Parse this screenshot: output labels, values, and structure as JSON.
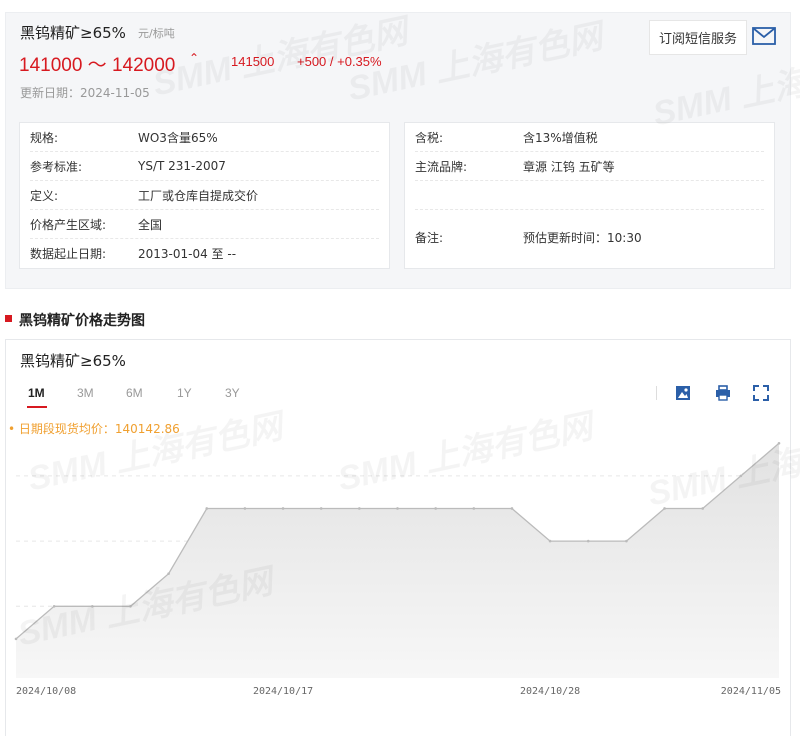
{
  "product": {
    "title": "黑钨精矿≥65%",
    "unit": "元/标吨",
    "price_range": "141000 ～ 142000",
    "trend_symbol": "⌃",
    "avg_price": "141500",
    "change": "+500 / +0.35%",
    "update_date": "更新日期：2024-11-05",
    "subscribe_label": "订阅短信服务"
  },
  "info_left": [
    {
      "key": "规格:",
      "value": "WO3含量65%"
    },
    {
      "key": "参考标准:",
      "value": "YS/T 231-2007"
    },
    {
      "key": "定义:",
      "value": "工厂或仓库自提成交价"
    },
    {
      "key": "价格产生区域:",
      "value": "全国"
    },
    {
      "key": "数据起止日期:",
      "value": "2013-01-04 至 --"
    }
  ],
  "info_right": [
    {
      "key": "含税:",
      "value": "含13%增值税"
    },
    {
      "key": "主流品牌:",
      "value": "章源 江钨 五矿等"
    },
    {
      "key": "",
      "value": ""
    },
    {
      "key": "备注:",
      "value": "预估更新时间：10:30"
    }
  ],
  "section_title": "黑钨精矿价格走势图",
  "chart_panel": {
    "title": "黑钨精矿≥65%",
    "tabs": [
      "1M",
      "3M",
      "6M",
      "1Y",
      "3Y"
    ],
    "active_tab": "1M",
    "avg_text": "• 日期段现货均价：140142.86"
  },
  "watermark": "SMM 上海有色网",
  "colors": {
    "accent": "#d71920",
    "avg_label": "#f0a030",
    "line": "#bbbbbb",
    "area": "#ececec"
  },
  "chart_data": {
    "type": "area",
    "title": "黑钨精矿≥65%",
    "x": [
      "2024/10/08",
      "2024/10/09",
      "2024/10/10",
      "2024/10/11",
      "2024/10/14",
      "2024/10/15",
      "2024/10/16",
      "2024/10/17",
      "2024/10/18",
      "2024/10/21",
      "2024/10/22",
      "2024/10/23",
      "2024/10/24",
      "2024/10/25",
      "2024/10/28",
      "2024/10/29",
      "2024/10/30",
      "2024/10/31",
      "2024/11/01",
      "2024/11/04",
      "2024/11/05"
    ],
    "series": [
      {
        "values": [
          138500,
          139000,
          139000,
          139000,
          139500,
          140500,
          140500,
          140500,
          140500,
          140500,
          140500,
          140500,
          140500,
          140500,
          140000,
          140000,
          140000,
          140500,
          140500,
          141000,
          141500
        ]
      }
    ],
    "x_tick_labels": [
      "2024/10/08",
      "2024/10/17",
      "2024/10/28",
      "2024/11/05"
    ],
    "y_ticks": [
      138000,
      139000,
      140000,
      141000
    ],
    "ylim": [
      137900,
      141550
    ],
    "grid": true
  }
}
